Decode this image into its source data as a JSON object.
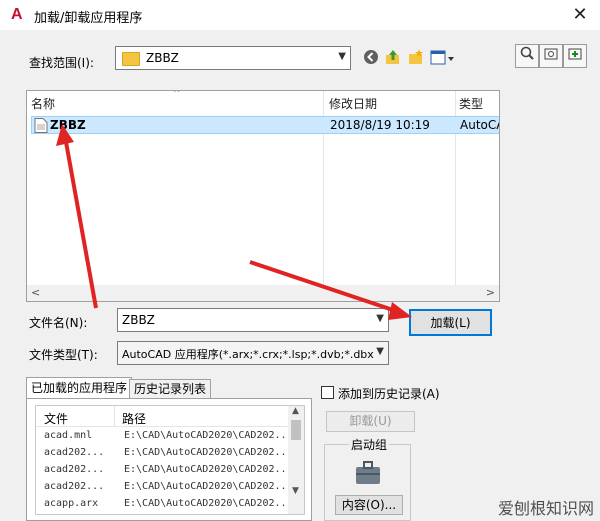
{
  "window": {
    "title": "加载/卸载应用程序",
    "close_glyph": "✕"
  },
  "lookin": {
    "label": "查找范围(I):",
    "value": "ZBBZ"
  },
  "toolbar_icons": [
    "back-icon",
    "up-folder-icon",
    "new-folder-icon",
    "views-icon"
  ],
  "right_icons": [
    "find-icon",
    "tools-icon",
    "add-icon"
  ],
  "filelist": {
    "columns": [
      "名称",
      "修改日期",
      "类型"
    ],
    "rows": [
      {
        "name": "ZBBZ",
        "date": "2018/8/19 10:19",
        "type": "AutoCA"
      }
    ]
  },
  "filename": {
    "label": "文件名(N):",
    "value": "ZBBZ"
  },
  "filetype": {
    "label": "文件类型(T):",
    "value": "AutoCAD 应用程序(*.arx;*.crx;*.lsp;*.dvb;*.dbx"
  },
  "load_button": "加载(L)",
  "tabs": [
    "已加载的应用程序",
    "历史记录列表"
  ],
  "loaded": {
    "columns": [
      "文件",
      "路径"
    ],
    "rows": [
      {
        "file": "acad.mnl",
        "path": "E:\\CAD\\AutoCAD2020\\CAD202..."
      },
      {
        "file": "acad202...",
        "path": "E:\\CAD\\AutoCAD2020\\CAD202..."
      },
      {
        "file": "acad202...",
        "path": "E:\\CAD\\AutoCAD2020\\CAD202..."
      },
      {
        "file": "acad202...",
        "path": "E:\\CAD\\AutoCAD2020\\CAD202..."
      },
      {
        "file": "acapp.arx",
        "path": "E:\\CAD\\AutoCAD2020\\CAD202..."
      }
    ]
  },
  "add_history": "添加到历史记录(A)",
  "unload_button": "卸载(U)",
  "startup": {
    "label": "启动组",
    "contents_button": "内容(O)..."
  },
  "watermark": "爱刨根知识网"
}
